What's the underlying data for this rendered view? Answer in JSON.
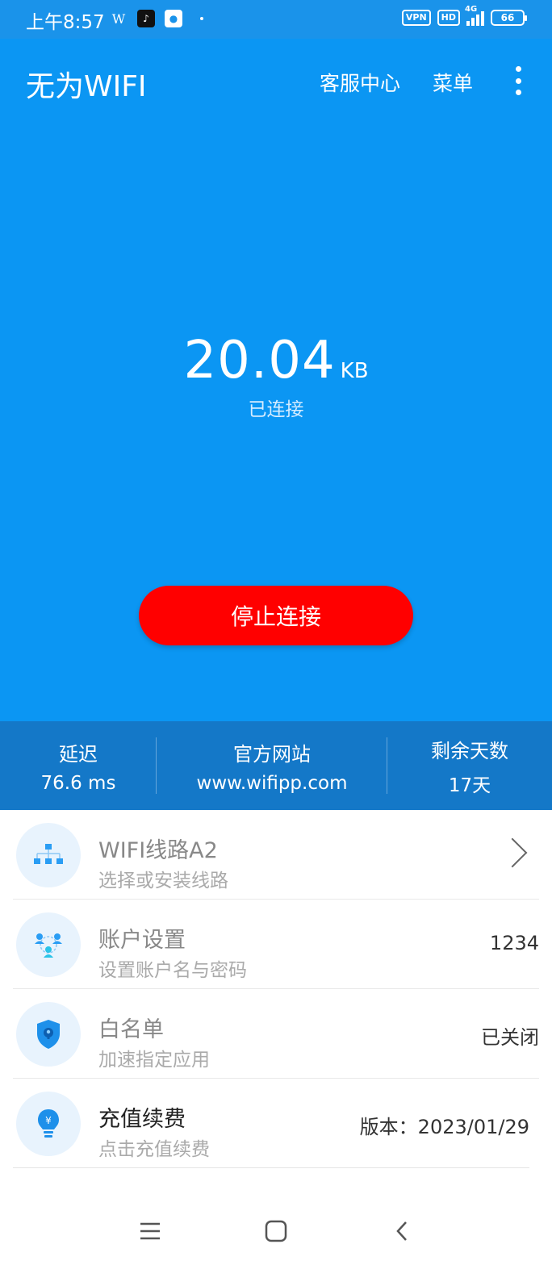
{
  "status_bar": {
    "time": "上午8:57",
    "vpn_badge": "VPN",
    "hd_badge": "HD",
    "network": "4G",
    "battery": "66"
  },
  "header": {
    "app_title": "无为WIFI",
    "service_center": "客服中心",
    "menu": "菜单"
  },
  "hero": {
    "traffic_value": "20.04",
    "traffic_unit": "KB",
    "status": "已连接",
    "stop_button": "停止连接"
  },
  "stats": [
    {
      "label": "延迟",
      "value": "76.6 ms"
    },
    {
      "label": "官方网站",
      "value": "www.wifipp.com"
    },
    {
      "label": "剩余天数",
      "value": "17天"
    }
  ],
  "list": [
    {
      "title": "WIFI线路A2",
      "subtitle": "选择或安装线路",
      "right": "",
      "icon": "network-route-icon"
    },
    {
      "title": "账户设置",
      "subtitle": "设置账户名与密码",
      "right": "1234",
      "icon": "users-icon"
    },
    {
      "title": "白名单",
      "subtitle": "加速指定应用",
      "right": "已关闭",
      "icon": "shield-icon"
    },
    {
      "title": "充值续费",
      "subtitle": "点击充值续费",
      "right": "版本：2023/01/29",
      "icon": "lightbulb-yuan-icon"
    }
  ],
  "colors": {
    "primary_blue": "#0b96f3",
    "stats_blue": "#1478c8",
    "stop_red": "#ff0000"
  }
}
